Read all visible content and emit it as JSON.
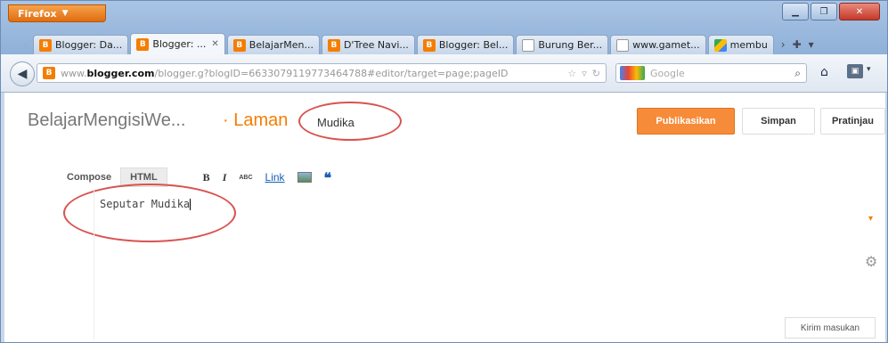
{
  "browser": {
    "app_button": "Firefox",
    "tabs": [
      {
        "label": "Blogger: Da...",
        "favicon": "blogger"
      },
      {
        "label": "Blogger: ...",
        "favicon": "blogger",
        "active": true
      },
      {
        "label": "BelajarMen...",
        "favicon": "blogger"
      },
      {
        "label": "D'Tree Navi...",
        "favicon": "blogger"
      },
      {
        "label": "Blogger: Bel...",
        "favicon": "blogger"
      },
      {
        "label": "Burung Ber...",
        "favicon": "blank"
      },
      {
        "label": "www.gamet...",
        "favicon": "blank"
      },
      {
        "label": "membu",
        "favicon": "multicolor"
      }
    ],
    "url": {
      "prefix": "www.",
      "domain": "blogger.com",
      "rest": "/blogger.g?blogID=6633079119773464788#editor/target=page;pageID"
    },
    "search_placeholder": "Google"
  },
  "editor": {
    "blog_name": "BelajarMengisiWe...",
    "page_type": "· Laman",
    "page_title": "Mudika",
    "publish_label": "Publikasikan",
    "save_label": "Simpan",
    "preview_label": "Pratinjau",
    "mode_compose": "Compose",
    "mode_html": "HTML",
    "toolbar": {
      "bold": "B",
      "italic": "I",
      "strike": "ABC",
      "link": "Link",
      "quote": "❝"
    },
    "body_text": "Seputar Mudika",
    "feedback_label": "Kirim masukan"
  },
  "colors": {
    "accent": "#f57d00",
    "publish": "#f68c3a",
    "annotation": "#d9534f"
  }
}
